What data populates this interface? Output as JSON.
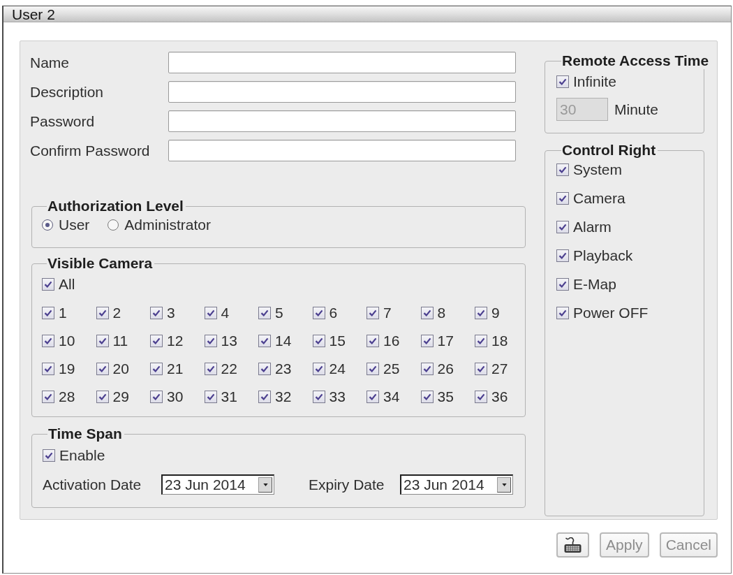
{
  "window": {
    "title": "User 2"
  },
  "fields": [
    {
      "label": "Name"
    },
    {
      "label": "Description"
    },
    {
      "label": "Password"
    },
    {
      "label": "Confirm Password"
    }
  ],
  "authorization_level": {
    "title": "Authorization Level",
    "options": [
      {
        "label": "User",
        "selected": true
      },
      {
        "label": "Administrator",
        "selected": false
      }
    ]
  },
  "visible_camera": {
    "title": "Visible Camera",
    "all": {
      "label": "All",
      "checked": true
    },
    "cameras": [
      {
        "label": "1",
        "checked": true
      },
      {
        "label": "2",
        "checked": true
      },
      {
        "label": "3",
        "checked": true
      },
      {
        "label": "4",
        "checked": true
      },
      {
        "label": "5",
        "checked": true
      },
      {
        "label": "6",
        "checked": true
      },
      {
        "label": "7",
        "checked": true
      },
      {
        "label": "8",
        "checked": true
      },
      {
        "label": "9",
        "checked": true
      },
      {
        "label": "10",
        "checked": true
      },
      {
        "label": "11",
        "checked": true
      },
      {
        "label": "12",
        "checked": true
      },
      {
        "label": "13",
        "checked": true
      },
      {
        "label": "14",
        "checked": true
      },
      {
        "label": "15",
        "checked": true
      },
      {
        "label": "16",
        "checked": true
      },
      {
        "label": "17",
        "checked": true
      },
      {
        "label": "18",
        "checked": true
      },
      {
        "label": "19",
        "checked": true
      },
      {
        "label": "20",
        "checked": true
      },
      {
        "label": "21",
        "checked": true
      },
      {
        "label": "22",
        "checked": true
      },
      {
        "label": "23",
        "checked": true
      },
      {
        "label": "24",
        "checked": true
      },
      {
        "label": "25",
        "checked": true
      },
      {
        "label": "26",
        "checked": true
      },
      {
        "label": "27",
        "checked": true
      },
      {
        "label": "28",
        "checked": true
      },
      {
        "label": "29",
        "checked": true
      },
      {
        "label": "30",
        "checked": true
      },
      {
        "label": "31",
        "checked": true
      },
      {
        "label": "32",
        "checked": true
      },
      {
        "label": "33",
        "checked": true
      },
      {
        "label": "34",
        "checked": true
      },
      {
        "label": "35",
        "checked": true
      },
      {
        "label": "36",
        "checked": true
      }
    ]
  },
  "time_span": {
    "title": "Time Span",
    "enable": {
      "label": "Enable",
      "checked": true
    },
    "dates": [
      {
        "label": "Activation Date",
        "value": "23 Jun 2014"
      },
      {
        "label": "Expiry Date",
        "value": "23 Jun 2014"
      }
    ]
  },
  "remote_access_time": {
    "title": "Remote Access Time",
    "infinite": {
      "label": "Infinite",
      "checked": true
    },
    "minutes": {
      "value": "30",
      "disabled": true
    },
    "unit": "Minute"
  },
  "control_right": {
    "title": "Control Right",
    "items": [
      {
        "label": "System",
        "checked": true
      },
      {
        "label": "Camera",
        "checked": true
      },
      {
        "label": "Alarm",
        "checked": true
      },
      {
        "label": "Playback",
        "checked": true
      },
      {
        "label": "E-Map",
        "checked": true
      },
      {
        "label": "Power OFF",
        "checked": true
      }
    ]
  },
  "buttons": [
    {
      "kind": "keyboard"
    },
    {
      "kind": "text",
      "label": "Apply"
    },
    {
      "kind": "text",
      "label": "Cancel"
    }
  ]
}
